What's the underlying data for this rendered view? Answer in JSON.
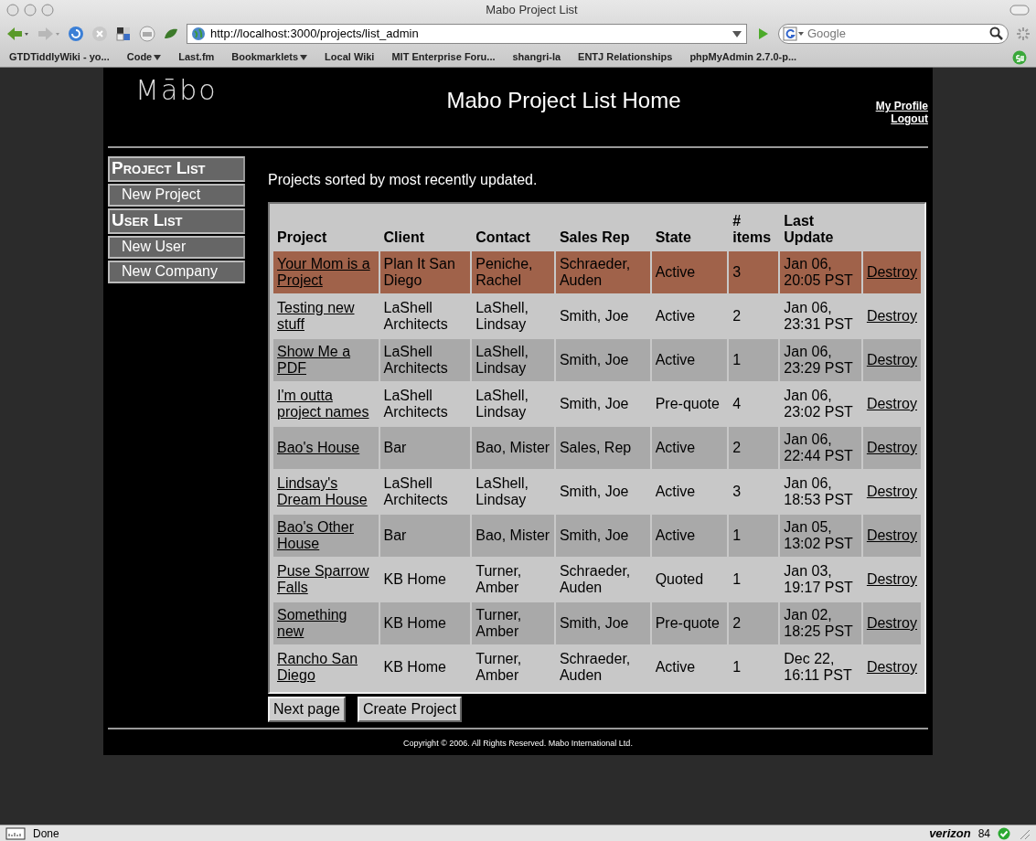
{
  "window": {
    "title": "Mabo Project List"
  },
  "toolbar": {
    "url": "http://localhost:3000/projects/list_admin",
    "search_placeholder": "Google"
  },
  "bookmarks": [
    {
      "label": "GTDTiddlyWiki - yo...",
      "menu": false
    },
    {
      "label": "Code",
      "menu": true
    },
    {
      "label": "Last.fm",
      "menu": false
    },
    {
      "label": "Bookmarklets",
      "menu": true
    },
    {
      "label": "Local Wiki",
      "menu": false
    },
    {
      "label": "MIT Enterprise Foru...",
      "menu": false
    },
    {
      "label": "shangri-la",
      "menu": false
    },
    {
      "label": "ENTJ Relationships",
      "menu": false
    },
    {
      "label": "phpMyAdmin 2.7.0-p...",
      "menu": false
    }
  ],
  "header": {
    "logo": "Mābo",
    "title": "Mabo Project List Home",
    "links": [
      "My Profile",
      "Logout"
    ]
  },
  "sidebar": {
    "items": [
      {
        "label": "Project List",
        "kind": "heading"
      },
      {
        "label": "New Project",
        "kind": "link"
      },
      {
        "label": "User List",
        "kind": "heading"
      },
      {
        "label": "New User",
        "kind": "link"
      },
      {
        "label": "New Company",
        "kind": "link"
      }
    ]
  },
  "intro": "Projects sorted by most recently updated.",
  "table": {
    "columns": [
      "Project",
      "Client",
      "Contact",
      "Sales Rep",
      "State",
      "# items",
      "Last Update"
    ],
    "rows": [
      {
        "selected": true,
        "cells": [
          "Your Mom is a Project",
          "Plan It San Diego",
          "Peniche, Rachel",
          "Schraeder, Auden",
          "Active",
          "3",
          "Jan 06, 20:05 PST"
        ],
        "action": "Destroy"
      },
      {
        "selected": false,
        "cells": [
          "Testing new stuff",
          "LaShell Architects",
          "LaShell, Lindsay",
          "Smith, Joe",
          "Active",
          "2",
          "Jan 06, 23:31 PST"
        ],
        "action": "Destroy"
      },
      {
        "selected": false,
        "cells": [
          "Show Me a PDF",
          "LaShell Architects",
          "LaShell, Lindsay",
          "Smith, Joe",
          "Active",
          "1",
          "Jan 06, 23:29 PST"
        ],
        "action": "Destroy"
      },
      {
        "selected": false,
        "cells": [
          "I'm outta project names",
          "LaShell Architects",
          "LaShell, Lindsay",
          "Smith, Joe",
          "Pre-quote",
          "4",
          "Jan 06, 23:02 PST"
        ],
        "action": "Destroy"
      },
      {
        "selected": false,
        "cells": [
          "Bao's House",
          "Bar",
          "Bao, Mister",
          "Sales, Rep",
          "Active",
          "2",
          "Jan 06, 22:44 PST"
        ],
        "action": "Destroy"
      },
      {
        "selected": false,
        "cells": [
          "Lindsay's Dream House",
          "LaShell Architects",
          "LaShell, Lindsay",
          "Smith, Joe",
          "Active",
          "3",
          "Jan 06, 18:53 PST"
        ],
        "action": "Destroy"
      },
      {
        "selected": false,
        "cells": [
          "Bao's Other House",
          "Bar",
          "Bao, Mister",
          "Smith, Joe",
          "Active",
          "1",
          "Jan 05, 13:02 PST"
        ],
        "action": "Destroy"
      },
      {
        "selected": false,
        "cells": [
          "Puse Sparrow Falls",
          "KB Home",
          "Turner, Amber",
          "Schraeder, Auden",
          "Quoted",
          "1",
          "Jan 03, 19:17 PST"
        ],
        "action": "Destroy"
      },
      {
        "selected": false,
        "cells": [
          "Something new",
          "KB Home",
          "Turner, Amber",
          "Smith, Joe",
          "Pre-quote",
          "2",
          "Jan 02, 18:25 PST"
        ],
        "action": "Destroy"
      },
      {
        "selected": false,
        "cells": [
          "Rancho San Diego",
          "KB Home",
          "Turner, Amber",
          "Schraeder, Auden",
          "Active",
          "1",
          "Dec 22, 16:11 PST"
        ],
        "action": "Destroy"
      }
    ]
  },
  "buttons": [
    "Next page",
    "Create Project"
  ],
  "footer": "Copyright © 2006. All Rights Reserved. Mabo International Ltd.",
  "status_bar": {
    "text": "Done",
    "carrier": "verizon",
    "count": "84"
  }
}
